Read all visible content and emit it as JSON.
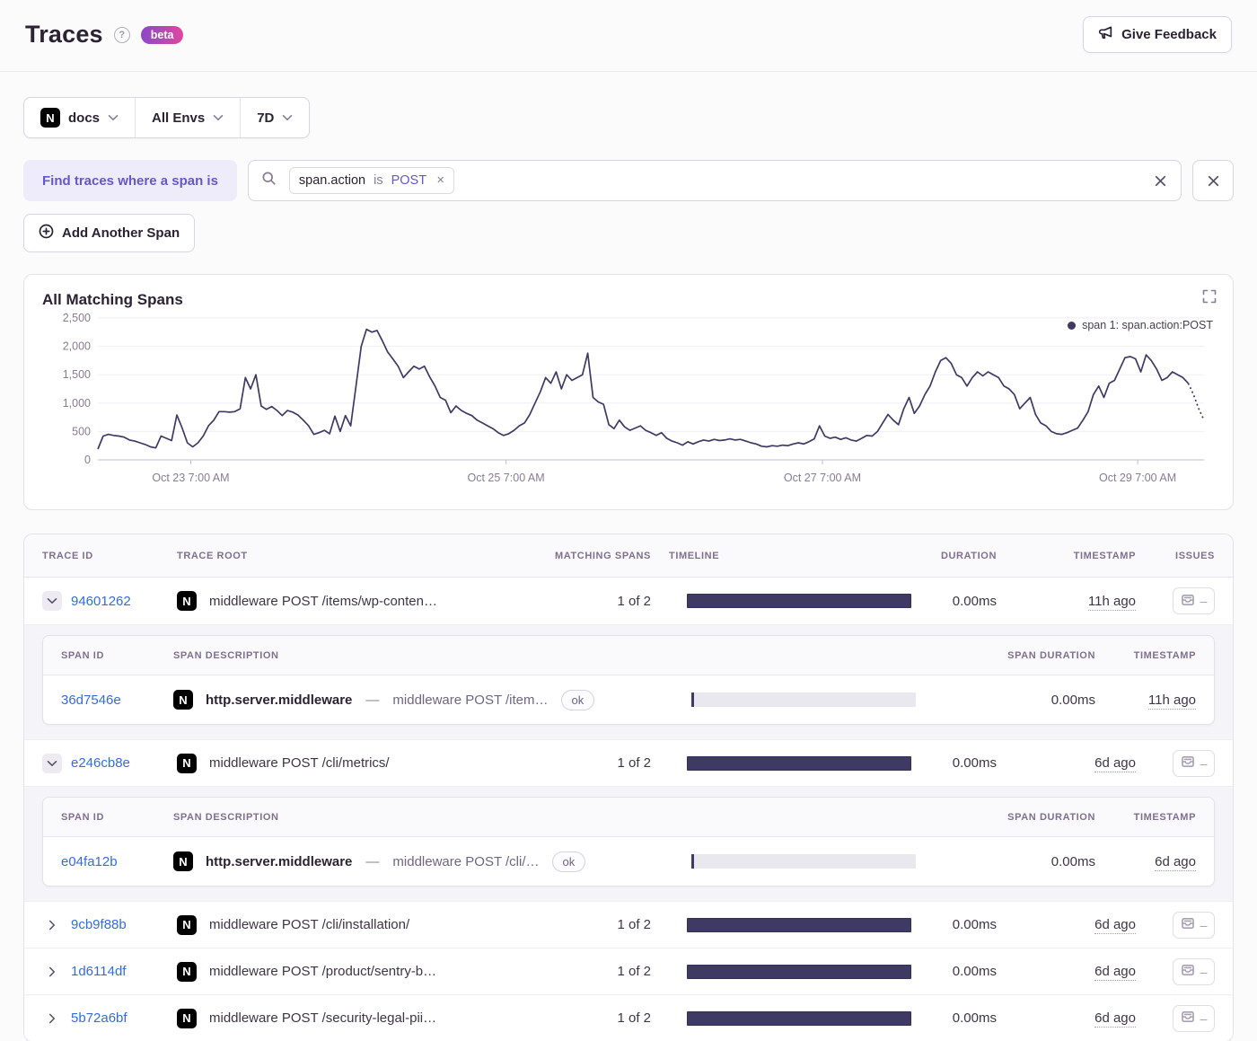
{
  "header": {
    "title": "Traces",
    "beta_label": "beta",
    "feedback_label": "Give Feedback"
  },
  "filters": {
    "project": "docs",
    "environment": "All Envs",
    "period": "7D"
  },
  "span_query": {
    "label": "Find traces where a span is",
    "token": {
      "key": "span.action",
      "op": "is",
      "value": "POST"
    },
    "add_button": "Add Another Span"
  },
  "chart": {
    "title": "All Matching Spans",
    "legend": "span 1: span.action:POST"
  },
  "chart_data": {
    "type": "line",
    "title": "All Matching Spans",
    "series_name": "span 1: span.action:POST",
    "color": "#3f3a63",
    "y_max": 2500,
    "y_ticks": [
      0,
      500,
      1000,
      1500,
      2000,
      2500
    ],
    "y_tick_labels": [
      "0",
      "500",
      "1,000",
      "1,500",
      "2,000",
      "2,500"
    ],
    "x_tick_fractions": [
      0.084,
      0.369,
      0.655,
      0.94
    ],
    "x_tick_labels": [
      "Oct 23 7:00 AM",
      "Oct 25 7:00 AM",
      "Oct 27 7:00 AM",
      "Oct 29 7:00 AM"
    ],
    "grid": true,
    "legend_position": "top-right",
    "dotted_tail_points": 3,
    "values": [
      190,
      420,
      450,
      430,
      420,
      400,
      350,
      330,
      300,
      270,
      230,
      210,
      420,
      380,
      340,
      790,
      560,
      300,
      230,
      300,
      420,
      600,
      700,
      850,
      850,
      840,
      850,
      900,
      1450,
      1250,
      1500,
      950,
      890,
      940,
      870,
      780,
      870,
      840,
      790,
      700,
      600,
      450,
      480,
      520,
      460,
      770,
      500,
      780,
      600,
      1300,
      2000,
      2300,
      2250,
      2280,
      2100,
      1900,
      1780,
      1650,
      1450,
      1550,
      1650,
      1600,
      1650,
      1460,
      1300,
      1100,
      1050,
      830,
      950,
      870,
      820,
      780,
      700,
      650,
      600,
      550,
      480,
      430,
      460,
      520,
      600,
      650,
      800,
      1000,
      1200,
      1450,
      1350,
      1550,
      1250,
      1500,
      1400,
      1450,
      1500,
      1880,
      1100,
      1020,
      980,
      620,
      550,
      700,
      580,
      520,
      560,
      600,
      520,
      480,
      430,
      480,
      380,
      330,
      300,
      260,
      320,
      280,
      320,
      350,
      330,
      360,
      340,
      350,
      370,
      350,
      360,
      330,
      300,
      280,
      240,
      230,
      250,
      240,
      260,
      250,
      280,
      300,
      280,
      320,
      370,
      600,
      420,
      380,
      400,
      360,
      390,
      350,
      330,
      380,
      430,
      420,
      500,
      650,
      800,
      700,
      620,
      900,
      1100,
      820,
      950,
      1150,
      1300,
      1550,
      1750,
      1800,
      1700,
      1500,
      1450,
      1300,
      1450,
      1550,
      1480,
      1550,
      1500,
      1450,
      1300,
      1250,
      1150,
      900,
      1000,
      1100,
      800,
      650,
      600,
      500,
      460,
      450,
      480,
      520,
      560,
      700,
      850,
      1150,
      1300,
      1100,
      1350,
      1400,
      1600,
      1800,
      1820,
      1780,
      1550,
      1850,
      1750,
      1600,
      1400,
      1450,
      1550,
      1500,
      1450,
      1350,
      1150,
      900,
      700
    ]
  },
  "table": {
    "columns": [
      "Trace ID",
      "Trace Root",
      "Matching Spans",
      "Timeline",
      "Duration",
      "Timestamp",
      "Issues"
    ],
    "span_columns": [
      "Span ID",
      "Span Description",
      "Span Duration",
      "Timestamp"
    ],
    "rows": [
      {
        "id": "94601262",
        "expanded": true,
        "root": "middleware POST /items/wp-conten…",
        "matching": "1 of 2",
        "duration": "0.00ms",
        "timestamp": "11h ago",
        "spans": [
          {
            "id": "36d7546e",
            "op": "http.server.middleware",
            "dash": "—",
            "desc": "middleware POST /item…",
            "status": "ok",
            "duration": "0.00ms",
            "timestamp": "11h ago"
          }
        ]
      },
      {
        "id": "e246cb8e",
        "expanded": true,
        "root": "middleware POST /cli/metrics/",
        "matching": "1 of 2",
        "duration": "0.00ms",
        "timestamp": "6d ago",
        "spans": [
          {
            "id": "e04fa12b",
            "op": "http.server.middleware",
            "dash": "—",
            "desc": "middleware POST /cli/…",
            "status": "ok",
            "duration": "0.00ms",
            "timestamp": "6d ago"
          }
        ]
      },
      {
        "id": "9cb9f88b",
        "expanded": false,
        "root": "middleware POST /cli/installation/",
        "matching": "1 of 2",
        "duration": "0.00ms",
        "timestamp": "6d ago"
      },
      {
        "id": "1d6114df",
        "expanded": false,
        "root": "middleware POST /product/sentry-b…",
        "matching": "1 of 2",
        "duration": "0.00ms",
        "timestamp": "6d ago"
      },
      {
        "id": "5b72a6bf",
        "expanded": false,
        "root": "middleware POST /security-legal-pii…",
        "matching": "1 of 2",
        "duration": "0.00ms",
        "timestamp": "6d ago"
      }
    ]
  },
  "colors": {
    "accent_purple": "#6558c9",
    "link_blue": "#346ddb",
    "bar_navy": "#3f3a63",
    "beta_gradient_start": "#8b48c8",
    "beta_gradient_end": "#e0479e"
  }
}
